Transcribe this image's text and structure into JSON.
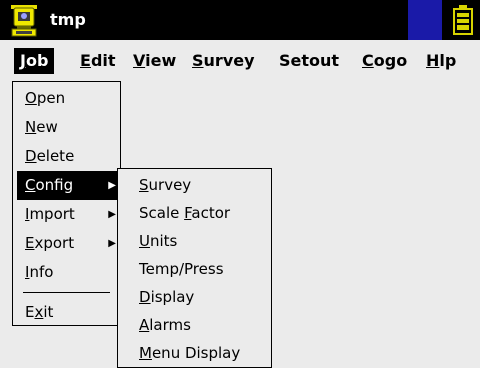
{
  "title_bar": {
    "title": "tmp",
    "app_icon": "surveying-instrument-icon",
    "status_icon": "battery-icon"
  },
  "menu_bar": {
    "items": [
      {
        "mnemonic": "J",
        "rest": "ob",
        "active": true
      },
      {
        "mnemonic": "E",
        "rest": "dit"
      },
      {
        "mnemonic": "V",
        "rest": "iew"
      },
      {
        "mnemonic": "S",
        "rest": "urvey"
      },
      {
        "mnemonic": "",
        "rest": "Setout"
      },
      {
        "mnemonic": "C",
        "rest": "ogo"
      },
      {
        "mnemonic": "H",
        "rest": "lp"
      }
    ]
  },
  "job_menu": {
    "items": [
      {
        "pre": "",
        "mnemonic": "O",
        "rest": "pen"
      },
      {
        "pre": "",
        "mnemonic": "N",
        "rest": "ew"
      },
      {
        "pre": "",
        "mnemonic": "D",
        "rest": "elete"
      },
      {
        "pre": "",
        "mnemonic": "C",
        "rest": "onfig",
        "submenu": true,
        "selected": true
      },
      {
        "pre": "",
        "mnemonic": "I",
        "rest": "mport",
        "submenu": true
      },
      {
        "pre": "",
        "mnemonic": "E",
        "rest": "xport",
        "submenu": true
      },
      {
        "pre": "",
        "mnemonic": "I",
        "rest": "nfo"
      },
      {
        "pre": "E",
        "mnemonic": "x",
        "rest": "it"
      }
    ],
    "submenu_arrow": "▶"
  },
  "config_submenu": {
    "items": [
      {
        "pre": "",
        "mnemonic": "S",
        "rest": "urvey"
      },
      {
        "pre": "Scale ",
        "mnemonic": "F",
        "rest": "actor"
      },
      {
        "pre": "",
        "mnemonic": "U",
        "rest": "nits"
      },
      {
        "pre": "Temp/Press",
        "mnemonic": "",
        "rest": ""
      },
      {
        "pre": "",
        "mnemonic": "D",
        "rest": "isplay"
      },
      {
        "pre": "",
        "mnemonic": "A",
        "rest": "larms"
      },
      {
        "pre": "",
        "mnemonic": "M",
        "rest": "enu Display"
      }
    ]
  },
  "colors": {
    "title_bar": "#000000",
    "background": "#ebebeb",
    "selection": "#000000",
    "status_blue": "#1a1aa8",
    "battery": "#d8d400"
  }
}
